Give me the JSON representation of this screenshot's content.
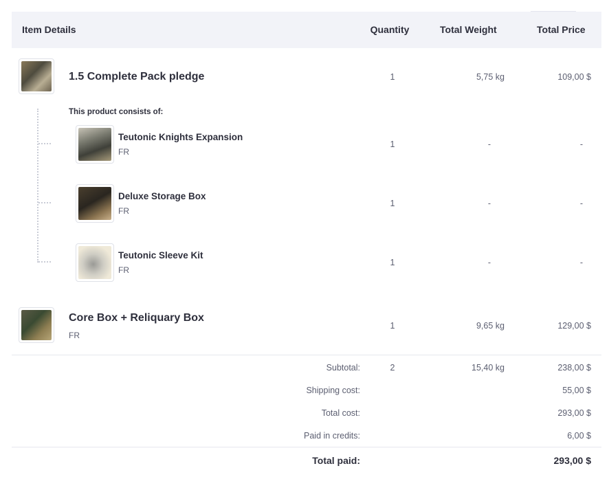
{
  "header": {
    "item_details": "Item Details",
    "quantity": "Quantity",
    "total_weight": "Total Weight",
    "total_price": "Total Price"
  },
  "items": [
    {
      "name": "1.5 Complete Pack pledge",
      "quantity": "1",
      "weight": "5,75 kg",
      "price": "109,00 $",
      "consists_label": "This product consists of:",
      "sub_items": [
        {
          "name": "Teutonic Knights Expansion",
          "lang": "FR",
          "quantity": "1",
          "weight": "-",
          "price": "-"
        },
        {
          "name": "Deluxe Storage Box",
          "lang": "FR",
          "quantity": "1",
          "weight": "-",
          "price": "-"
        },
        {
          "name": "Teutonic Sleeve Kit",
          "lang": "FR",
          "quantity": "1",
          "weight": "-",
          "price": "-"
        }
      ]
    },
    {
      "name": "Core Box + Reliquary Box",
      "lang": "FR",
      "quantity": "1",
      "weight": "9,65 kg",
      "price": "129,00 $"
    }
  ],
  "totals": {
    "subtotal_label": "Subtotal:",
    "subtotal_qty": "2",
    "subtotal_weight": "15,40 kg",
    "subtotal_price": "238,00 $",
    "shipping_label": "Shipping cost:",
    "shipping_price": "55,00 $",
    "total_cost_label": "Total cost:",
    "total_cost_price": "293,00 $",
    "credits_label": "Paid in credits:",
    "credits_price": "6,00 $",
    "total_paid_label": "Total paid:",
    "total_paid_price": "293,00 $"
  }
}
